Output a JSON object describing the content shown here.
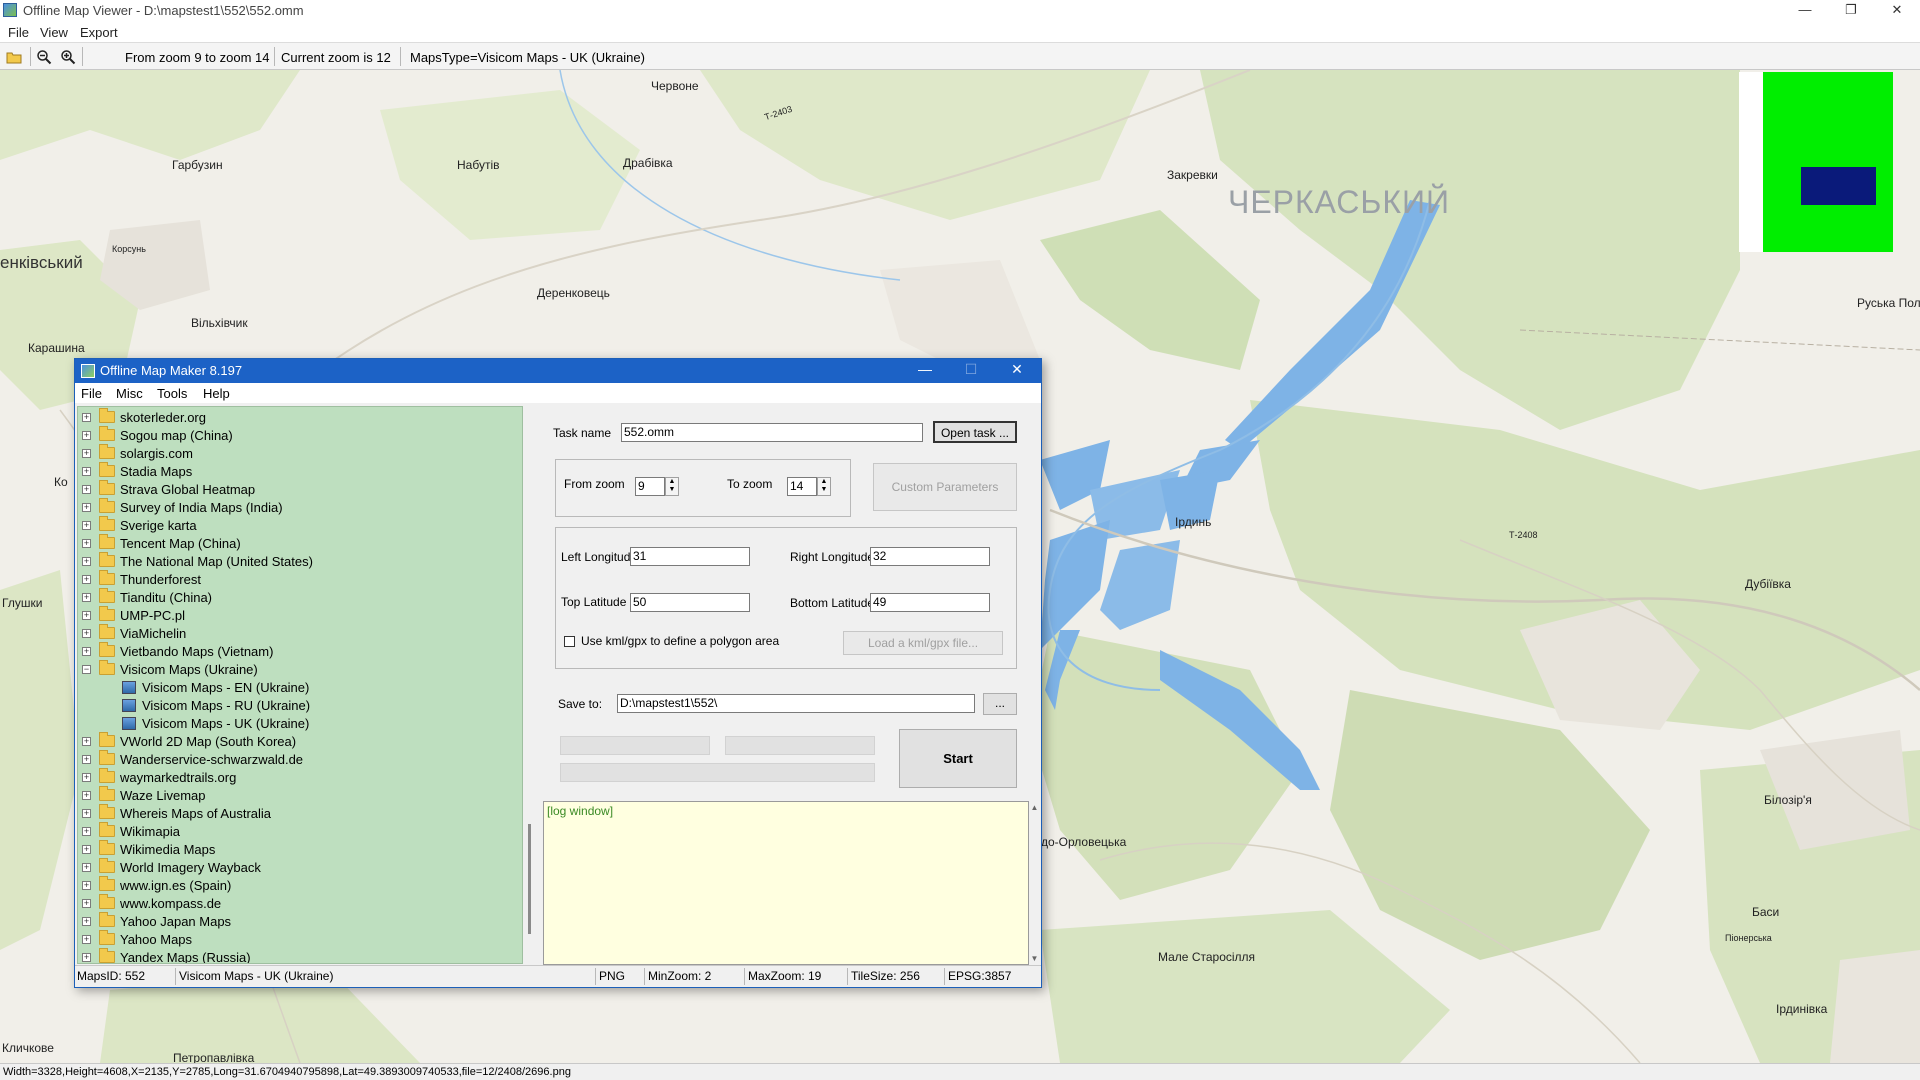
{
  "window": {
    "title": "Offline Map Viewer - D:\\mapstest1\\552\\552.omm",
    "controls": {
      "minimize": "—",
      "restore": "❐",
      "close": "✕"
    }
  },
  "menu": {
    "file": "File",
    "view": "View",
    "export": "Export"
  },
  "toolbar": {
    "icons": [
      "open-folder-icon",
      "zoom-out-icon",
      "zoom-in-icon"
    ],
    "zoom_range": "From zoom 9 to zoom 14",
    "current_zoom": "Current zoom is 12",
    "maps_type": "MapsType=Visicom Maps - UK (Ukraine)"
  },
  "map": {
    "places": [
      {
        "name": "Червоне"
      },
      {
        "name": "Гарбузин"
      },
      {
        "name": "Набутів"
      },
      {
        "name": "Драбівка"
      },
      {
        "name": "Закревки"
      },
      {
        "name": "ЧЕРКАСЬКИЙ",
        "style": "big"
      },
      {
        "name": "енківський",
        "style": "medium"
      },
      {
        "name": "Корсунь"
      },
      {
        "name": "Деренковець"
      },
      {
        "name": "Вільхівчик"
      },
      {
        "name": "Карашина"
      },
      {
        "name": "Руська Пол"
      },
      {
        "name": "Ко"
      },
      {
        "name": "Глушки"
      },
      {
        "name": "Ірдинь"
      },
      {
        "name": "Т-2408"
      },
      {
        "name": "Дубіївка"
      },
      {
        "name": "Т-2403"
      },
      {
        "name": "до-Орловецька"
      },
      {
        "name": "Білозір'я"
      },
      {
        "name": "Баси"
      },
      {
        "name": "Піонерська"
      },
      {
        "name": "Мале Старосілля"
      },
      {
        "name": "Ірдинівка"
      },
      {
        "name": "Кличкове"
      },
      {
        "name": "Петропавлівка"
      }
    ]
  },
  "viewer_status": "Width=3328,Height=4608,X=2135,Y=2785,Long=31.6704940795898,Lat=49.3893009740533,file=12/2408/2696.png",
  "dialog": {
    "title": "Offline Map Maker 8.197",
    "controls": {
      "minimize": "—",
      "maximize": "☐",
      "close": "✕"
    },
    "menu": {
      "file": "File",
      "misc": "Misc",
      "tools": "Tools",
      "help": "Help"
    },
    "tree": [
      {
        "label": "skoterleder.org",
        "type": "folder"
      },
      {
        "label": "Sogou map (China)",
        "type": "folder"
      },
      {
        "label": "solargis.com",
        "type": "folder"
      },
      {
        "label": "Stadia Maps",
        "type": "folder"
      },
      {
        "label": "Strava Global Heatmap",
        "type": "folder"
      },
      {
        "label": "Survey of India Maps (India)",
        "type": "folder"
      },
      {
        "label": "Sverige karta",
        "type": "folder"
      },
      {
        "label": "Tencent Map (China)",
        "type": "folder"
      },
      {
        "label": "The National Map (United States)",
        "type": "folder"
      },
      {
        "label": "Thunderforest",
        "type": "folder"
      },
      {
        "label": "Tianditu (China)",
        "type": "folder"
      },
      {
        "label": "UMP-PC.pl",
        "type": "folder"
      },
      {
        "label": "ViaMichelin",
        "type": "folder"
      },
      {
        "label": "Vietbando Maps (Vietnam)",
        "type": "folder"
      },
      {
        "label": "Visicom Maps (Ukraine)",
        "type": "open-folder"
      },
      {
        "label": "Visicom Maps - EN (Ukraine)",
        "type": "map"
      },
      {
        "label": "Visicom Maps - RU (Ukraine)",
        "type": "map"
      },
      {
        "label": "Visicom Maps - UK (Ukraine)",
        "type": "map"
      },
      {
        "label": "VWorld 2D Map (South Korea)",
        "type": "folder"
      },
      {
        "label": "Wanderservice-schwarzwald.de",
        "type": "folder"
      },
      {
        "label": "waymarkedtrails.org",
        "type": "folder"
      },
      {
        "label": "Waze Livemap",
        "type": "folder"
      },
      {
        "label": "Whereis Maps of Australia",
        "type": "folder"
      },
      {
        "label": "Wikimapia",
        "type": "folder"
      },
      {
        "label": "Wikimedia Maps",
        "type": "folder"
      },
      {
        "label": "World Imagery Wayback",
        "type": "folder"
      },
      {
        "label": "www.ign.es (Spain)",
        "type": "folder"
      },
      {
        "label": "www.kompass.de",
        "type": "folder"
      },
      {
        "label": "Yahoo Japan Maps",
        "type": "folder"
      },
      {
        "label": "Yahoo Maps",
        "type": "folder"
      },
      {
        "label": "Yandex Maps (Russia)",
        "type": "folder"
      }
    ],
    "task_name_label": "Task name",
    "task_name_value": "552.omm",
    "open_task_label": "Open task ...",
    "from_zoom_label": "From zoom",
    "from_zoom_value": "9",
    "to_zoom_label": "To zoom",
    "to_zoom_value": "14",
    "custom_params_label": "Custom Parameters",
    "left_lon_label": "Left Longitude",
    "left_lon_value": "31",
    "right_lon_label": "Right Longitude",
    "right_lon_value": "32",
    "top_lat_label": "Top Latitude",
    "top_lat_value": "50",
    "bottom_lat_label": "Bottom Latitude",
    "bottom_lat_value": "49",
    "kml_checkbox_label": "Use kml/gpx to define a polygon area",
    "load_kml_label": "Load a kml/gpx file...",
    "save_to_label": "Save to:",
    "save_to_value": "D:\\mapstest1\\552\\",
    "browse_label": "...",
    "start_label": "Start",
    "log_text": "[log window]",
    "status": {
      "maps_id": "MapsID: 552",
      "maps_name": "Visicom Maps - UK (Ukraine)",
      "format": "PNG",
      "min_zoom": "MinZoom: 2",
      "max_zoom": "MaxZoom: 19",
      "tile_size": "TileSize: 256",
      "epsg": "EPSG:3857"
    }
  }
}
